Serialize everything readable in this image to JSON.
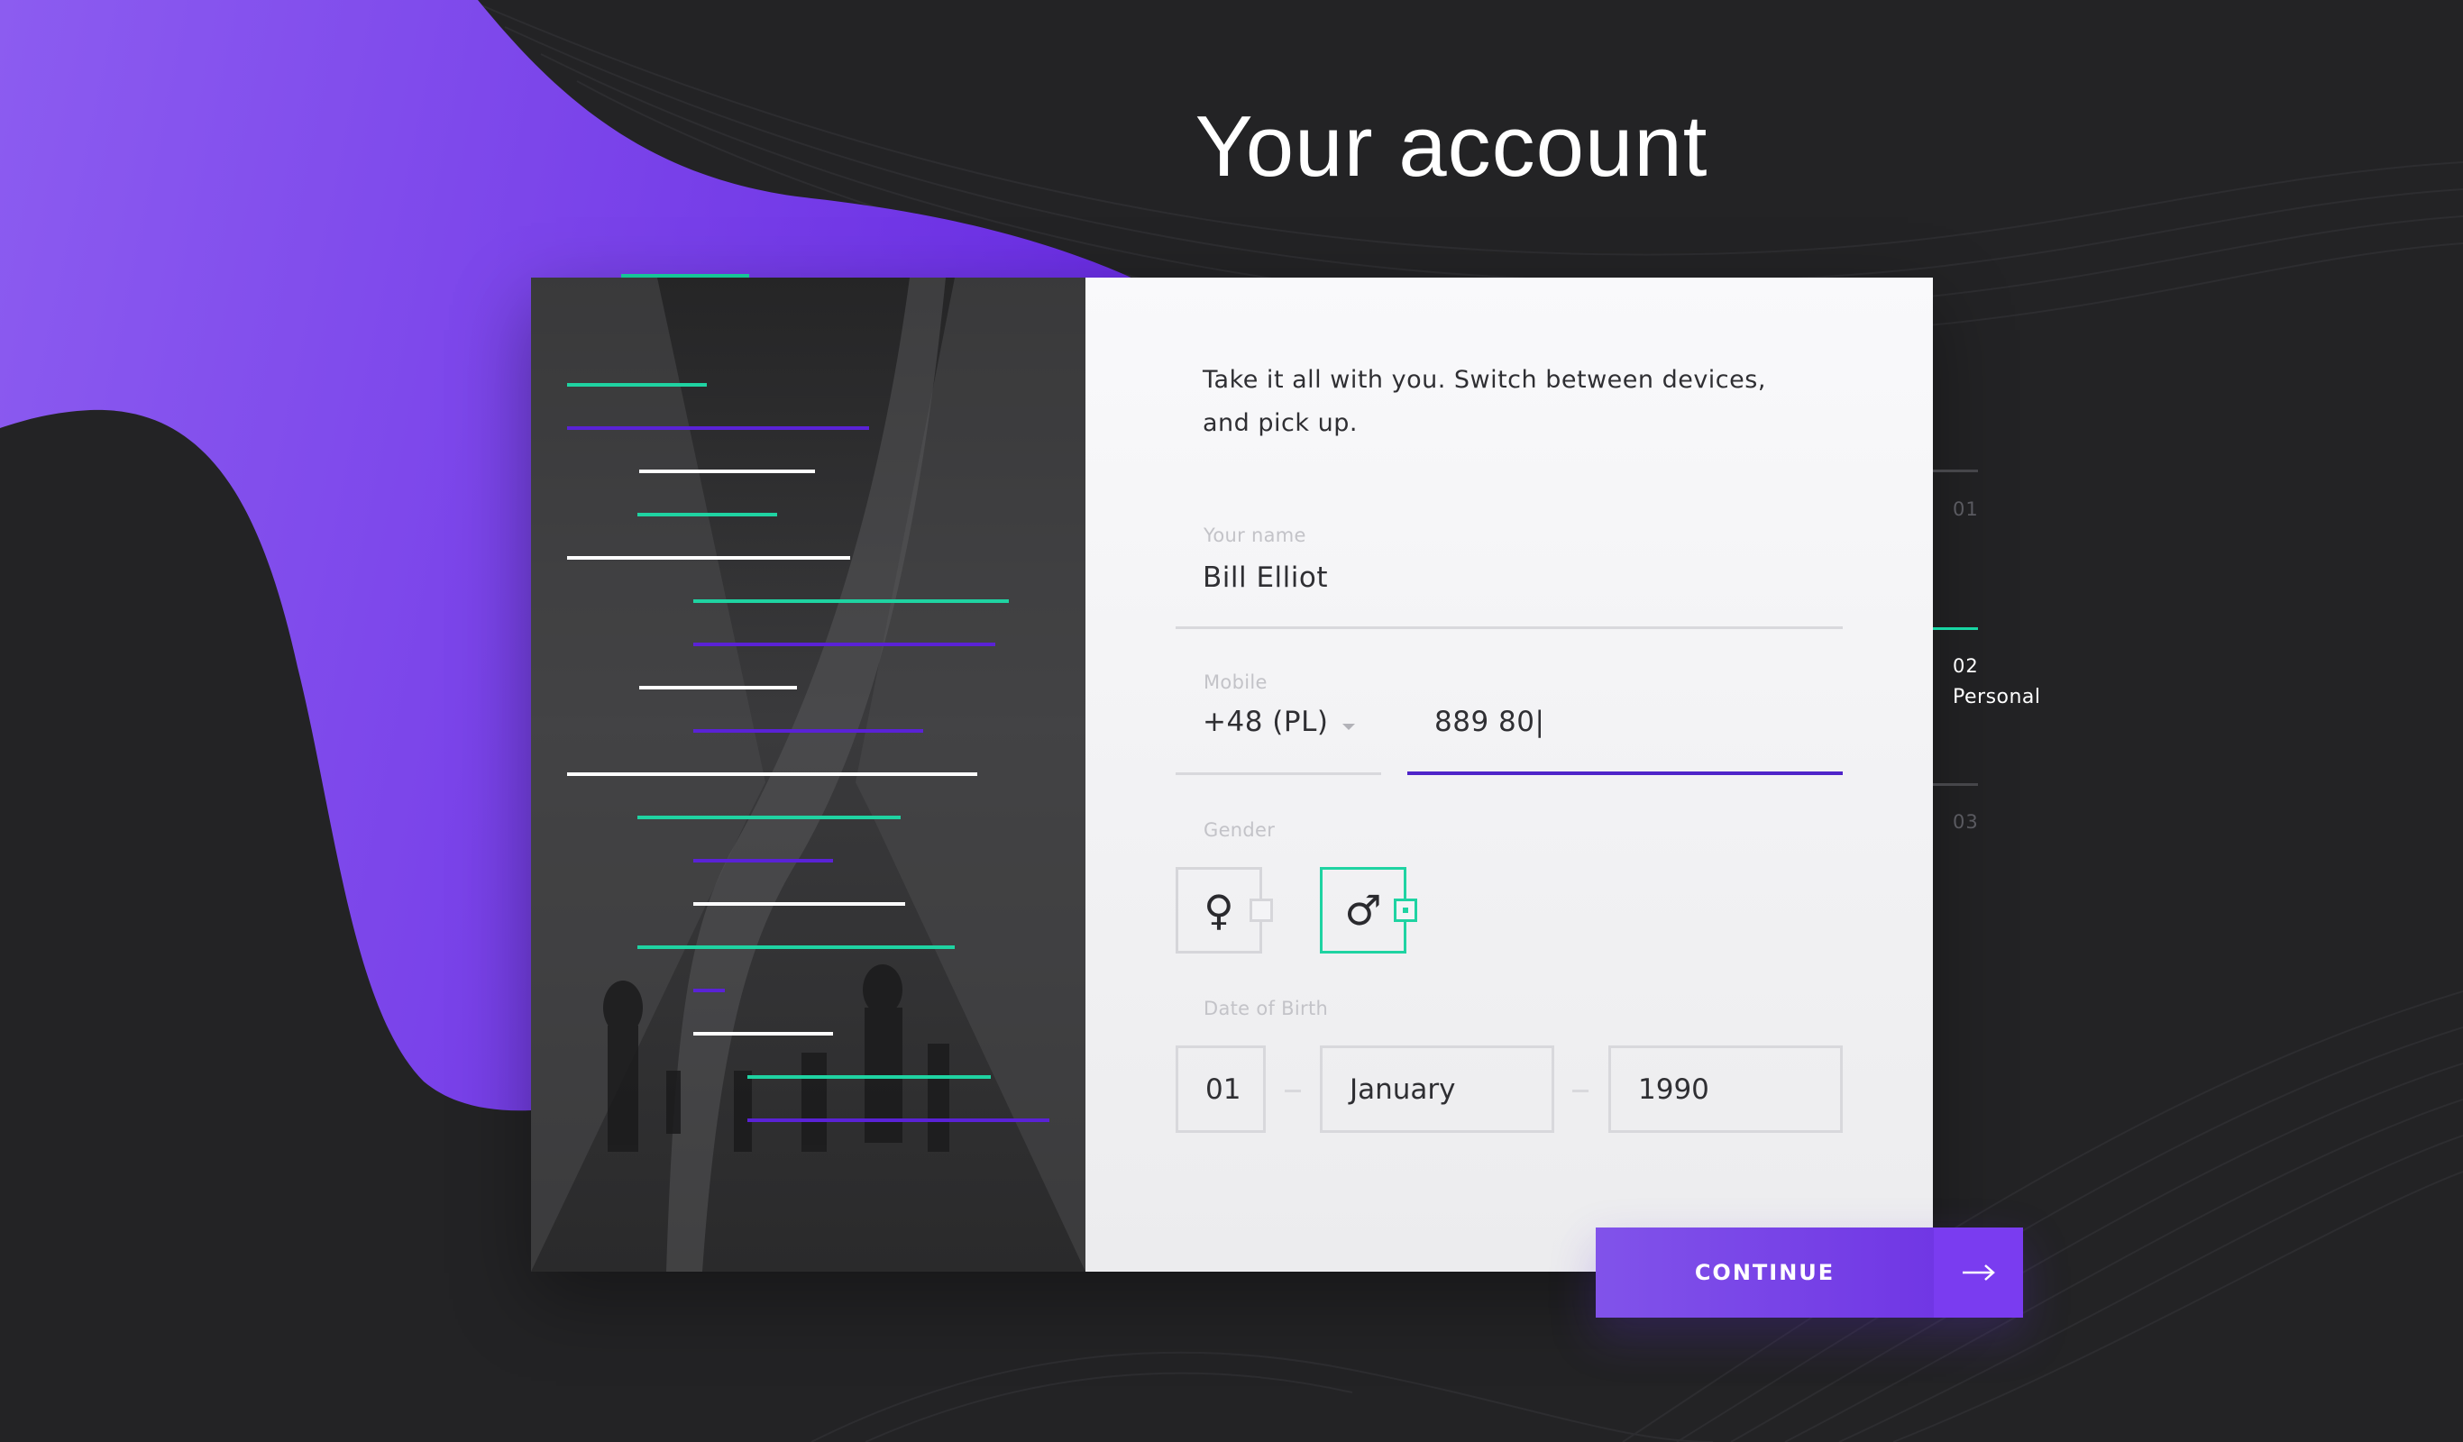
{
  "page": {
    "title": "Your account"
  },
  "form": {
    "intro": "Take it all with you. Switch between devices, and pick up.",
    "name": {
      "label": "Your name",
      "value": "Bill Elliot"
    },
    "mobile": {
      "label": "Mobile",
      "country_code": "+48 (PL)",
      "number": "889 80|"
    },
    "gender": {
      "label": "Gender",
      "options": [
        {
          "label": "female",
          "icon": "female-icon",
          "selected": false
        },
        {
          "label": "male",
          "icon": "male-icon",
          "selected": true
        }
      ],
      "female_symbol": "♀",
      "male_symbol": "♂"
    },
    "dob": {
      "label": "Date of Birth",
      "day": "01",
      "month": "January",
      "year": "1990"
    }
  },
  "continue_button": {
    "label": "CONTINUE",
    "icon": "arrow-right-icon"
  },
  "steps": [
    {
      "number": "01",
      "name": "",
      "active": false
    },
    {
      "number": "02",
      "name": "Personal",
      "active": true
    },
    {
      "number": "03",
      "name": "",
      "active": false
    }
  ],
  "colors": {
    "background": "#232325",
    "purple": "#6c2fe3",
    "purple_light": "#8153ea",
    "accent_green": "#18d6a4",
    "active_underline": "#4f25c9"
  }
}
